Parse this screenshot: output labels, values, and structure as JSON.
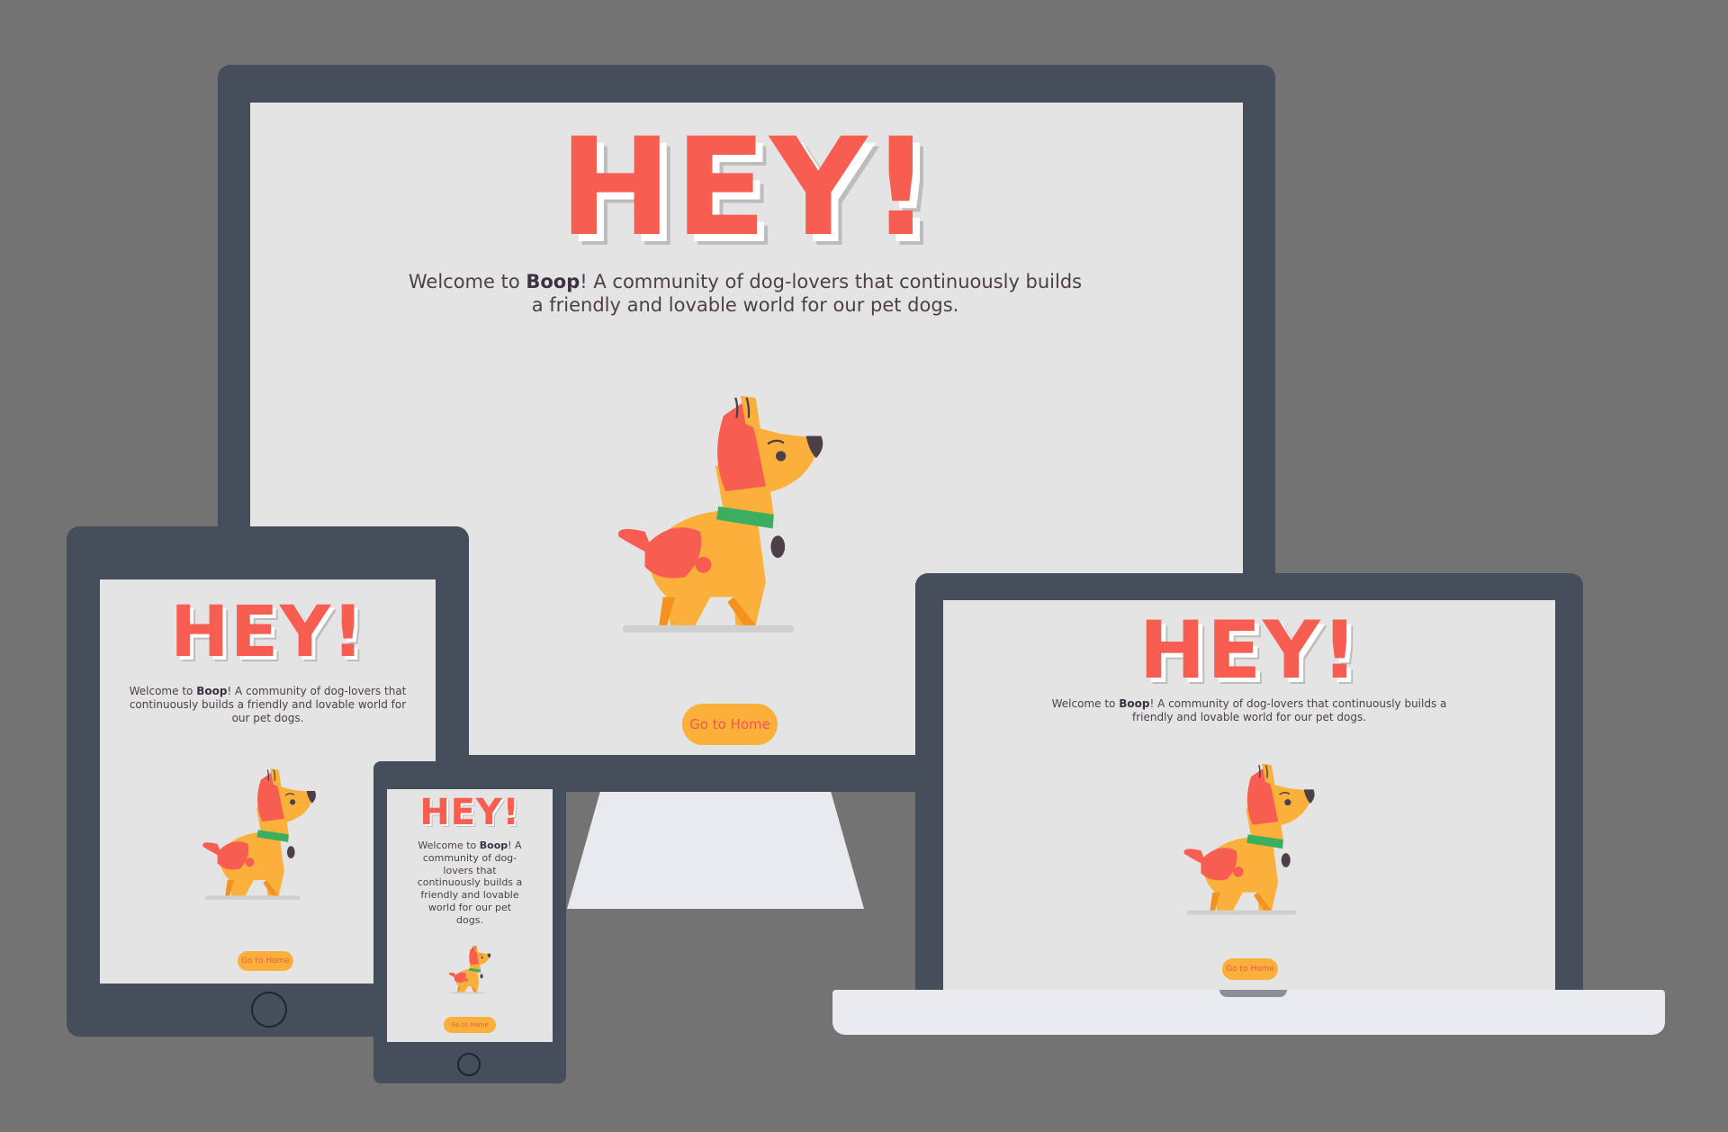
{
  "page": {
    "background": "#737373"
  },
  "hero": {
    "headline": "HEY!",
    "welcome_prefix": "Welcome to ",
    "brand": "Boop",
    "welcome_suffix": "! A community of dog-lovers that continuously builds a friendly and lovable world for our pet dogs.",
    "cta_label": "Go to Home"
  },
  "colors": {
    "device_frame": "#464d5b",
    "screen_bg": "#e4e4e4",
    "headline": "#f75d50",
    "cta_bg": "#fbb03b",
    "cta_text": "#f0584a",
    "text": "#4c3f4a",
    "dog_body": "#fbb03b",
    "dog_patch": "#f75d50",
    "dog_collar": "#3cae5f"
  },
  "devices": [
    "desktop-monitor",
    "tablet",
    "phone",
    "laptop"
  ],
  "icons": [
    "dog-illustration",
    "home-button-icon"
  ]
}
